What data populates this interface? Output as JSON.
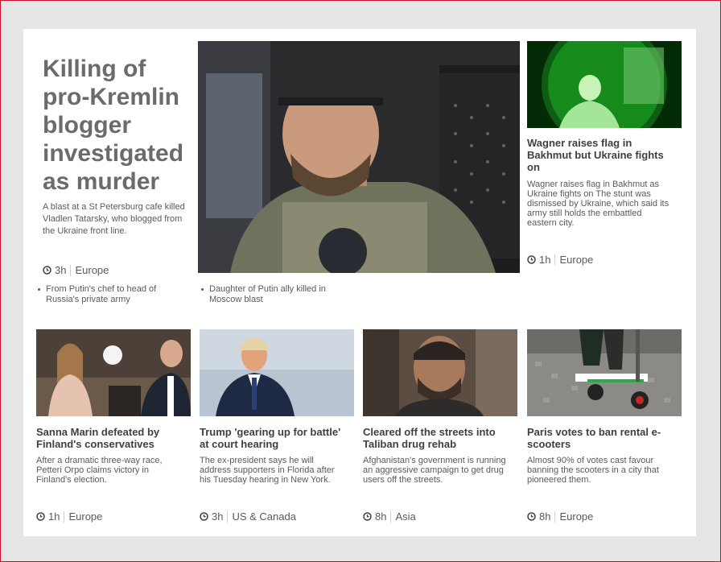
{
  "main_story": {
    "headline": "Killing of pro-Kremlin blogger investigated as murder",
    "summary": "A blast at a St Petersburg cafe killed Vladlen Tatarsky, who blogged from the Ukraine front line.",
    "time": "3h",
    "section": "Europe",
    "related": [
      "From Putin's chef to head of Russia's private army",
      "Daughter of Putin ally killed in Moscow blast"
    ],
    "image_alt": "Man in cap and camouflage vest seated in vehicle"
  },
  "side_story": {
    "title": "Wagner raises flag in Bakhmut but Ukraine fights on",
    "summary": "Wagner raises flag in Bakhmut as Ukraine fights on The stunt was dismissed by Ukraine, which said its army still holds the embattled eastern city.",
    "time": "1h",
    "section": "Europe",
    "image_alt": "Night-vision image of soldier"
  },
  "bottom_stories": [
    {
      "title": "Sanna Marin defeated by Finland's conservatives",
      "summary": "After a dramatic three-way race, Petteri Orpo claims victory in Finland's election.",
      "time": "1h",
      "section": "Europe"
    },
    {
      "title": "Trump 'gearing up for battle' at court hearing",
      "summary": "The ex-president says he will address supporters in Florida after his Tuesday hearing in New York.",
      "time": "3h",
      "section": "US & Canada"
    },
    {
      "title": "Cleared off the streets into Taliban drug rehab",
      "summary": "Afghanistan's government is running an aggressive campaign to get drug users off the streets.",
      "time": "8h",
      "section": "Asia"
    },
    {
      "title": "Paris votes to ban rental e-scooters",
      "summary": "Almost 90% of votes cast favour banning the scooters in a city that pioneered them.",
      "time": "8h",
      "section": "Europe"
    }
  ],
  "colors": {
    "page_bg": "#e6e6e6",
    "card_bg": "#ffffff",
    "border": "#c8102e",
    "text": "#404040",
    "headline": "#6b6b6b"
  }
}
